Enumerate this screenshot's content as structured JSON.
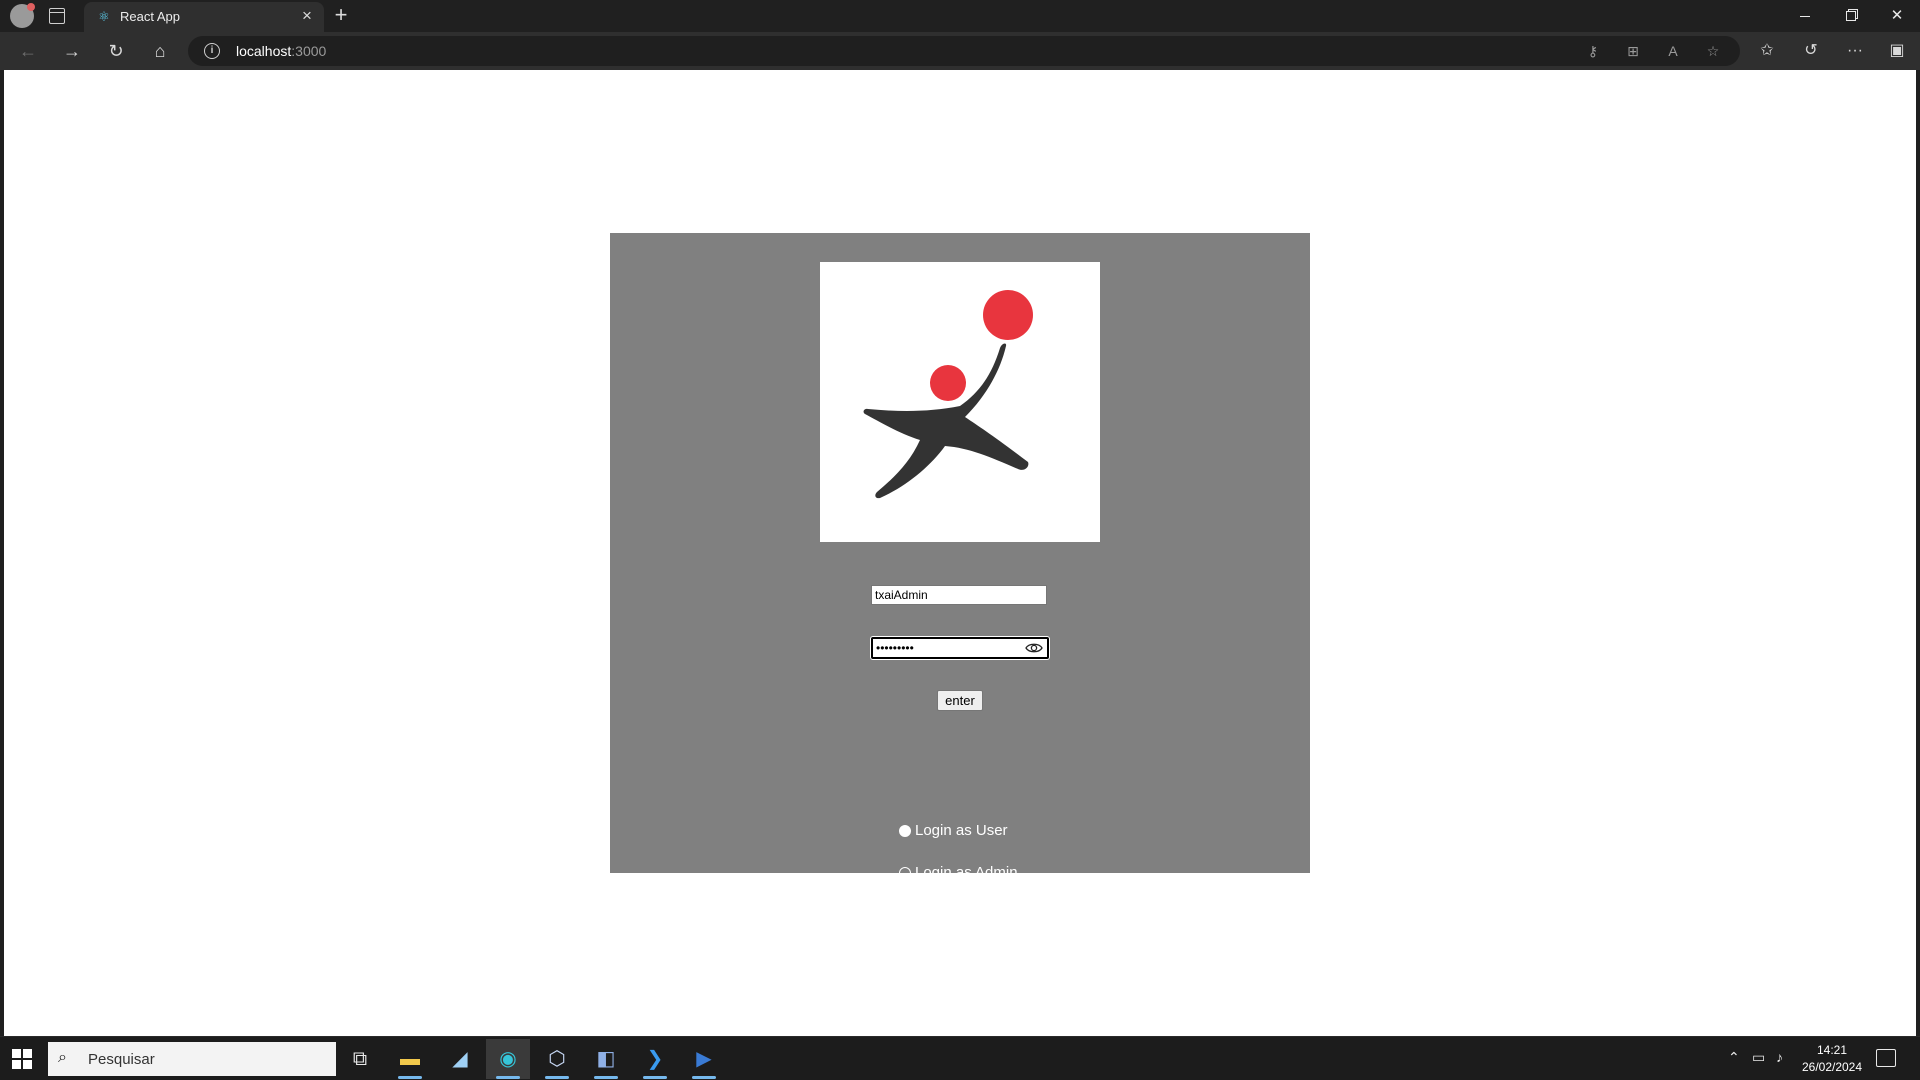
{
  "browser": {
    "tab_title": "React App",
    "url_host": "localhost",
    "url_port": ":3000"
  },
  "login": {
    "username_value": "txaiAdmin",
    "password_value": "txaiAdmin",
    "enter_label": "enter",
    "role_options": [
      {
        "label": "Login as User",
        "checked": true
      },
      {
        "label": "Login as Admin",
        "checked": false
      }
    ],
    "logo_colors": {
      "ball": "#e8353e",
      "figure": "#333333"
    },
    "card_color": "#808080"
  },
  "taskbar": {
    "search_placeholder": "Pesquisar",
    "time": "14:21",
    "date": "26/02/2024"
  }
}
